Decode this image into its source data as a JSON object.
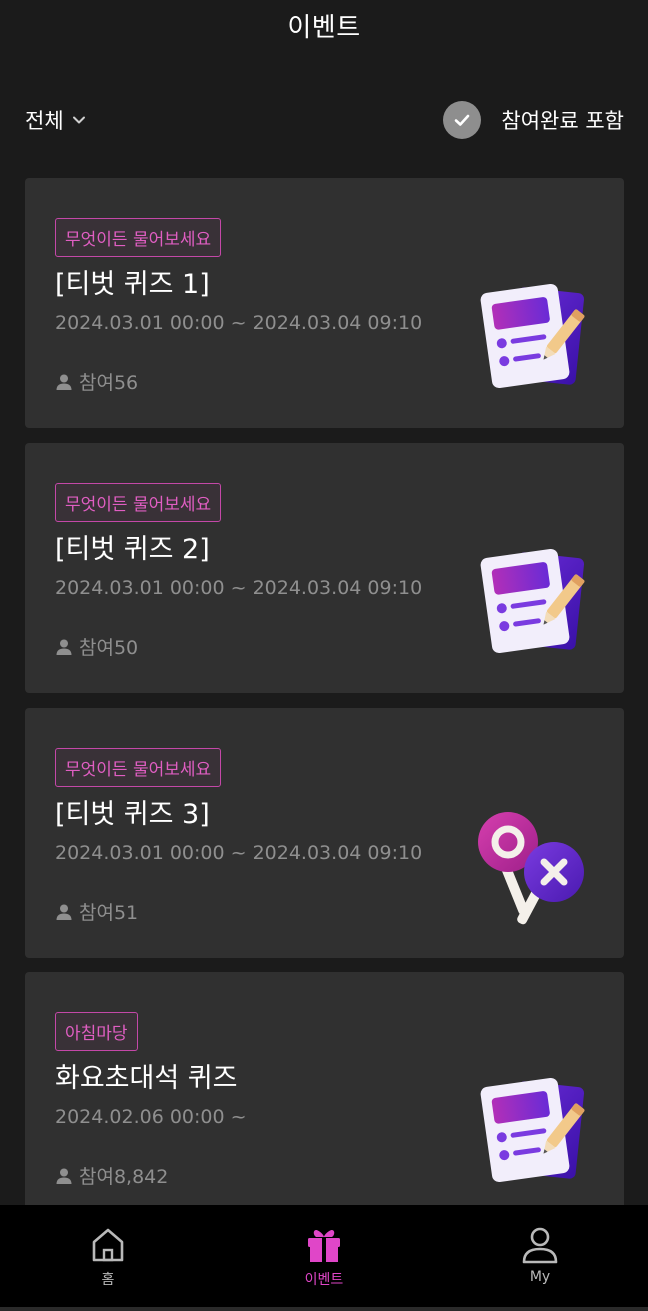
{
  "header": {
    "title": "이벤트"
  },
  "filter": {
    "category_label": "전체",
    "include_completed_label": "참여완료 포함"
  },
  "events": [
    {
      "badge": "무엇이든 물어보세요",
      "title": "[티벗 퀴즈 1]",
      "date": "2024.03.01 00:00 ~ 2024.03.04 09:10",
      "participants": "참여56",
      "icon": "quiz-document-icon"
    },
    {
      "badge": "무엇이든 물어보세요",
      "title": "[티벗 퀴즈 2]",
      "date": "2024.03.01 00:00 ~ 2024.03.04 09:10",
      "participants": "참여50",
      "icon": "quiz-document-icon"
    },
    {
      "badge": "무엇이든 물어보세요",
      "title": "[티벗 퀴즈 3]",
      "date": "2024.03.01 00:00 ~ 2024.03.04 09:10",
      "participants": "참여51",
      "icon": "ox-paddles-icon"
    },
    {
      "badge": "아침마당",
      "title": "화요초대석 퀴즈",
      "date": "2024.02.06 00:00 ~",
      "participants": "참여8,842",
      "icon": "quiz-document-icon"
    }
  ],
  "tabs": [
    {
      "label": "홈",
      "icon": "home-icon"
    },
    {
      "label": "이벤트",
      "icon": "gift-icon",
      "active": true
    },
    {
      "label": "My",
      "icon": "user-icon"
    }
  ],
  "colors": {
    "accent": "#e046c8",
    "card_bg": "#303030",
    "page_bg": "#1b1b1b",
    "badge_border": "#c448a8"
  }
}
